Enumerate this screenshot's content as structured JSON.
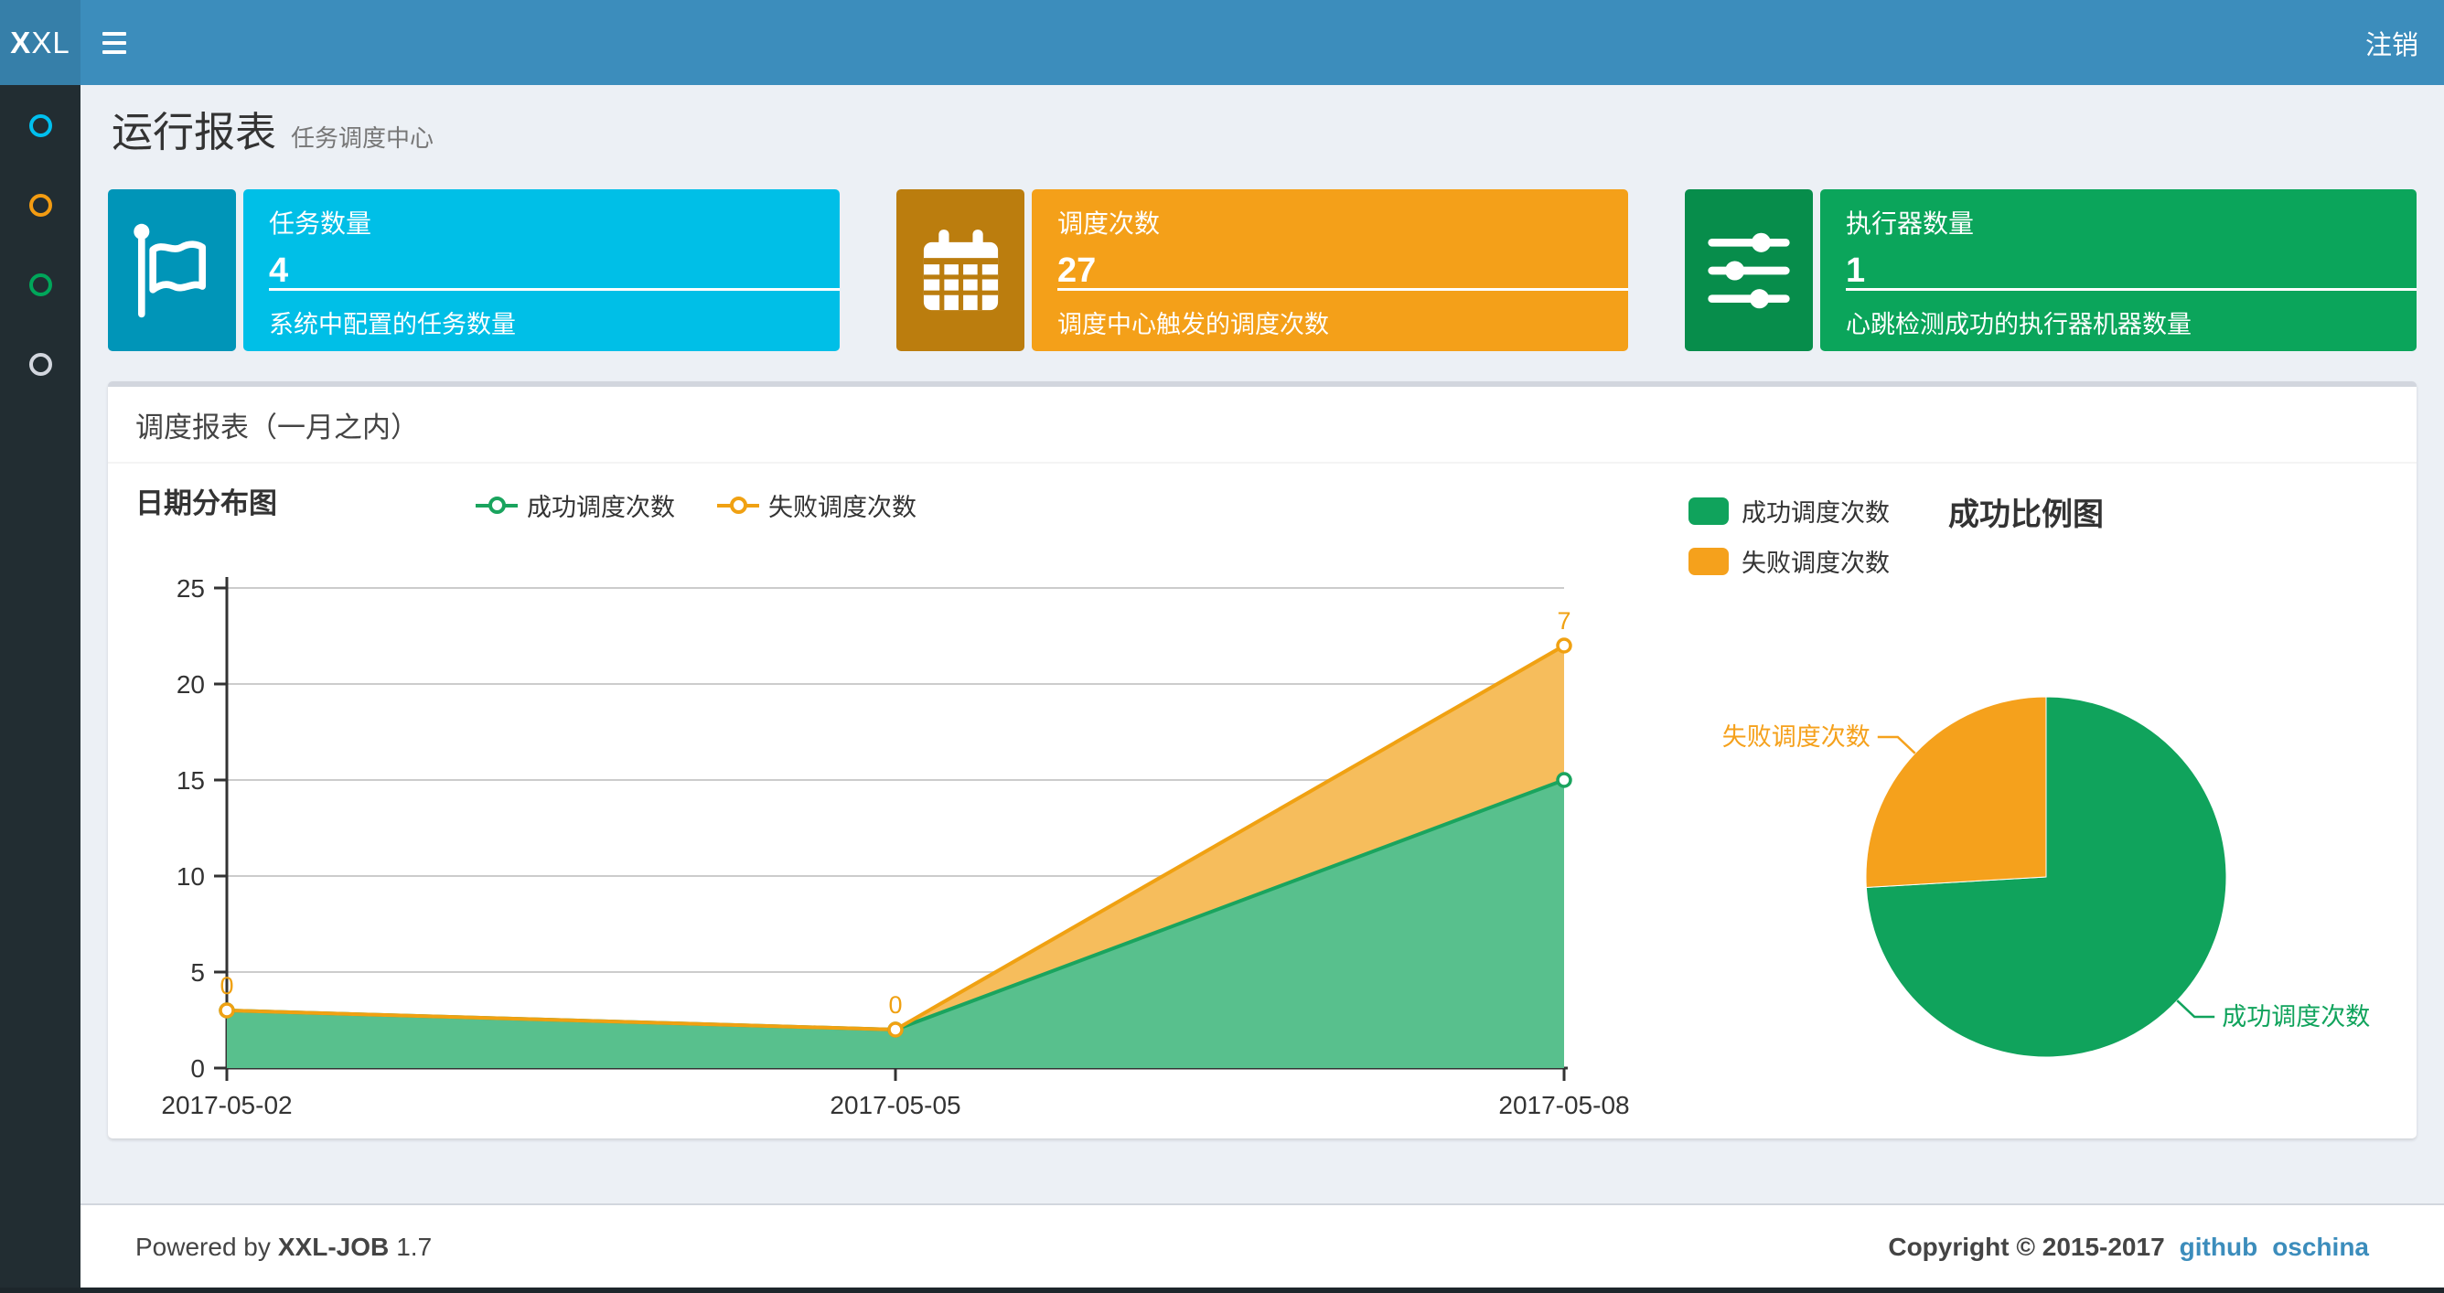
{
  "header": {
    "logo_bold": "X",
    "logo_rest": "XL",
    "logout_label": "注销"
  },
  "sidebar": {
    "items": [
      {
        "icon": "circle-icon",
        "color": "#00c0ef"
      },
      {
        "icon": "circle-icon",
        "color": "#f39c12"
      },
      {
        "icon": "circle-icon",
        "color": "#00a65a"
      },
      {
        "icon": "circle-icon",
        "color": "#d2d6de"
      }
    ]
  },
  "page": {
    "title": "运行报表",
    "subtitle": "任务调度中心"
  },
  "cards": [
    {
      "title": "任务数量",
      "value": "4",
      "desc": "系统中配置的任务数量",
      "icon": "flag-icon",
      "body_color": "#00bfe7",
      "icon_color": "#0095b8"
    },
    {
      "title": "调度次数",
      "value": "27",
      "desc": "调度中心触发的调度次数",
      "icon": "calendar-icon",
      "body_color": "#f4a019",
      "icon_color": "#bb7d0e"
    },
    {
      "title": "执行器数量",
      "value": "1",
      "desc": "心跳检测成功的执行器机器数量",
      "icon": "sliders-icon",
      "body_color": "#0ba55b",
      "icon_color": "#078d4b"
    }
  ],
  "panel": {
    "title": "调度报表（一月之内）"
  },
  "chart_data": [
    {
      "type": "area",
      "title": "日期分布图",
      "categories": [
        "2017-05-02",
        "2017-05-05",
        "2017-05-08"
      ],
      "series": [
        {
          "name": "成功调度次数",
          "values": [
            3,
            2,
            15
          ],
          "color": "#1aa45e",
          "fill": "#58c08d"
        },
        {
          "name": "失败调度次数",
          "values": [
            0,
            0,
            7
          ],
          "color": "#f0a112",
          "fill": "#f6bd5c",
          "point_labels": [
            "0",
            "0",
            "7"
          ]
        }
      ],
      "stacked": true,
      "ylim": [
        0,
        25
      ],
      "yticks": [
        0,
        5,
        10,
        15,
        20,
        25
      ],
      "grid": true,
      "legend_position": "top",
      "axis_color": "#333333",
      "grid_color": "#cccccc"
    },
    {
      "type": "pie",
      "title": "成功比例图",
      "slices": [
        {
          "name": "成功调度次数",
          "value": 20,
          "color": "#10a35c"
        },
        {
          "name": "失败调度次数",
          "value": 7,
          "color": "#f5a11c"
        }
      ],
      "legend_position": "top-left",
      "label_lines": true
    }
  ],
  "footer": {
    "powered_prefix": "Powered by",
    "product": "XXL-JOB",
    "version": "1.7",
    "copyright": "Copyright © 2015-2017",
    "links": [
      {
        "label": "github"
      },
      {
        "label": "oschina"
      }
    ]
  }
}
